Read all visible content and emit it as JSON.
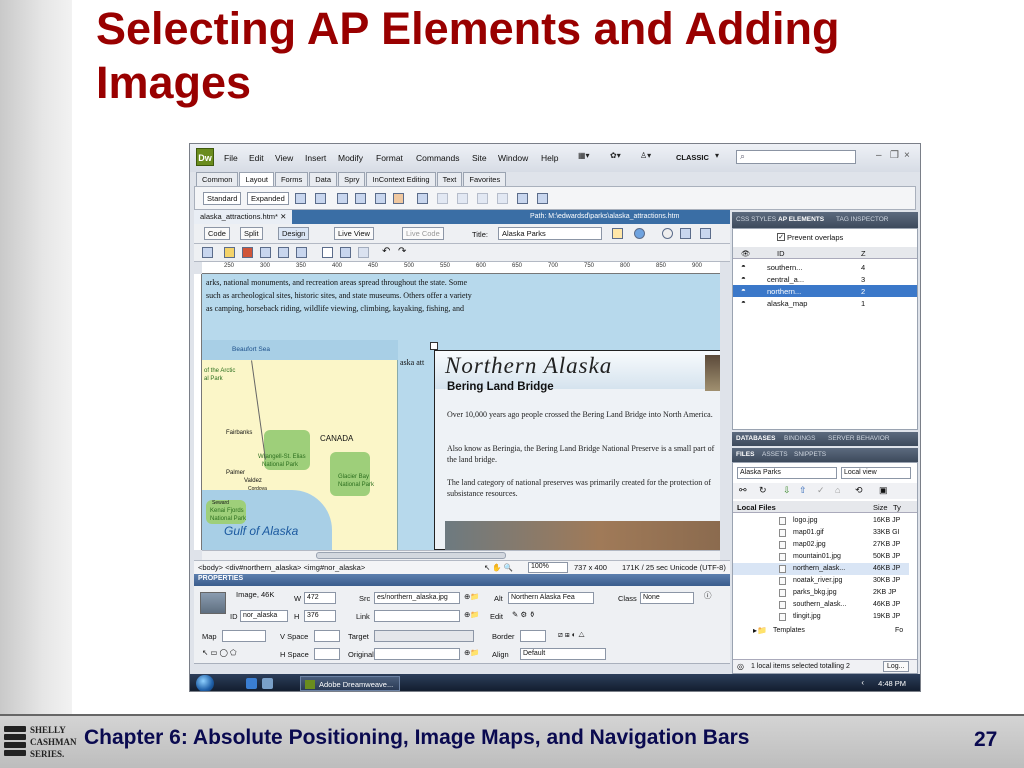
{
  "slide": {
    "title": "Selecting AP Elements and Adding Images",
    "footer": "Chapter 6: Absolute Positioning, Image Maps, and Navigation Bars",
    "page": "27",
    "logo": [
      "SHELLY",
      "CASHMAN",
      "SERIES."
    ]
  },
  "app": {
    "logo": "Dw",
    "menu": [
      "File",
      "Edit",
      "View",
      "Insert",
      "Modify",
      "Format",
      "Commands",
      "Site",
      "Window",
      "Help"
    ],
    "workspace": "CLASSIC",
    "insert_tabs": [
      "Common",
      "Layout",
      "Forms",
      "Data",
      "Spry",
      "InContext Editing",
      "Text",
      "Favorites"
    ],
    "active_insert_tab": "Layout",
    "mode_buttons": [
      "Standard",
      "Expanded"
    ]
  },
  "document": {
    "tab": "alaska_attractions.htm*",
    "path": "Path:  M:\\edwardsd\\parks\\alaska_attractions.htm",
    "views": [
      "Code",
      "Split",
      "Design",
      "Live View",
      "Live Code"
    ],
    "title_label": "Title:",
    "title_value": "Alaska Parks",
    "ruler": [
      "250",
      "300",
      "350",
      "400",
      "450",
      "500",
      "550",
      "600",
      "650",
      "700",
      "750",
      "800",
      "850",
      "900"
    ],
    "intro_lines": [
      "arks, national monuments, and recreation areas spread throughout the state. Some",
      "such as archeological sites, historic sites, and state museums. Others offer a variety",
      "as camping, horseback riding, wildlife viewing, climbing, kayaking, fishing, and"
    ],
    "map_caption": "aska att",
    "map_labels": {
      "beaufort": "Beaufort Sea",
      "arctic": "of the Arctic",
      "arctic2": "al Park",
      "fairbanks": "Fairbanks",
      "canada": "CANADA",
      "wrangell": "Wrangell-St. Elias",
      "wrangell2": "National Park",
      "palmer": "Palmer",
      "valdez": "Valdez",
      "cordova": "Cordova",
      "glacier": "Glacier Bay",
      "glacier2": "National Park",
      "seward": "Seward",
      "kenai": "Kenai Fjords",
      "kenai2": "National Park",
      "gulf": "Gulf of Alaska"
    },
    "ap_title": "Northern Alaska",
    "ap_subtitle": "Bering Land Bridge",
    "ap_paragraphs": [
      "Over 10,000 years ago people crossed the Bering Land Bridge into North America.",
      "Also know as Beringia, the Bering Land Bridge National Preserve is a small part of the land bridge.",
      "The land category of national preserves was primarily created for the protection of subsistance resources."
    ],
    "tag_selector": "<body> <div#northern_alaska> <img#nor_alaska>",
    "zoom": "100%",
    "window_size": "737 x 400",
    "download": "171K / 25 sec",
    "encoding": "Unicode (UTF-8)"
  },
  "properties": {
    "header": "PROPERTIES",
    "type": "Image, 46K",
    "w_label": "W",
    "w": "472",
    "h_label": "H",
    "h": "376",
    "id_label": "ID",
    "id": "nor_alaska",
    "src_label": "Src",
    "src": "es/northern_alaska.jpg",
    "link_label": "Link",
    "alt_label": "Alt",
    "alt": "Northern Alaska Fea",
    "class_label": "Class",
    "class": "None",
    "edit_label": "Edit",
    "map_label": "Map",
    "vspace_label": "V Space",
    "hspace_label": "H Space",
    "target_label": "Target",
    "original_label": "Original",
    "border_label": "Border",
    "align_label": "Align",
    "align": "Default"
  },
  "ap_panel": {
    "tabs": [
      "CSS STYLES",
      "AP ELEMENTS",
      "TAG INSPECTOR"
    ],
    "prevent_overlaps": "Prevent overlaps",
    "col_id": "ID",
    "col_z": "Z",
    "rows": [
      {
        "name": "southern...",
        "z": "4"
      },
      {
        "name": "central_a...",
        "z": "3"
      },
      {
        "name": "northern...",
        "z": "2"
      },
      {
        "name": "alaska_map",
        "z": "1"
      }
    ]
  },
  "files_panel": {
    "tabs_top": [
      "DATABASES",
      "BINDINGS",
      "SERVER BEHAVIOR"
    ],
    "tabs": [
      "FILES",
      "ASSETS",
      "SNIPPETS"
    ],
    "site": "Alaska Parks",
    "view": "Local view",
    "col_local": "Local Files",
    "col_size": "Size",
    "col_type": "Ty",
    "files": [
      {
        "name": "logo.jpg",
        "size": "16KB",
        "type": "JP"
      },
      {
        "name": "map01.gif",
        "size": "33KB",
        "type": "GI"
      },
      {
        "name": "map02.jpg",
        "size": "27KB",
        "type": "JP"
      },
      {
        "name": "mountain01.jpg",
        "size": "50KB",
        "type": "JP"
      },
      {
        "name": "northern_alask...",
        "size": "46KB",
        "type": "JP"
      },
      {
        "name": "noatak_river.jpg",
        "size": "30KB",
        "type": "JP"
      },
      {
        "name": "parks_bkg.jpg",
        "size": "2KB",
        "type": "JP"
      },
      {
        "name": "southern_alask...",
        "size": "46KB",
        "type": "JP"
      },
      {
        "name": "tlingit.jpg",
        "size": "19KB",
        "type": "JP"
      },
      {
        "name": "Templates",
        "size": "",
        "type": "Fo"
      }
    ],
    "status": "1 local items selected totalling 2",
    "log_button": "Log..."
  },
  "taskbar": {
    "app_button": "Adobe Dreamweave...",
    "clock": "4:48 PM"
  }
}
